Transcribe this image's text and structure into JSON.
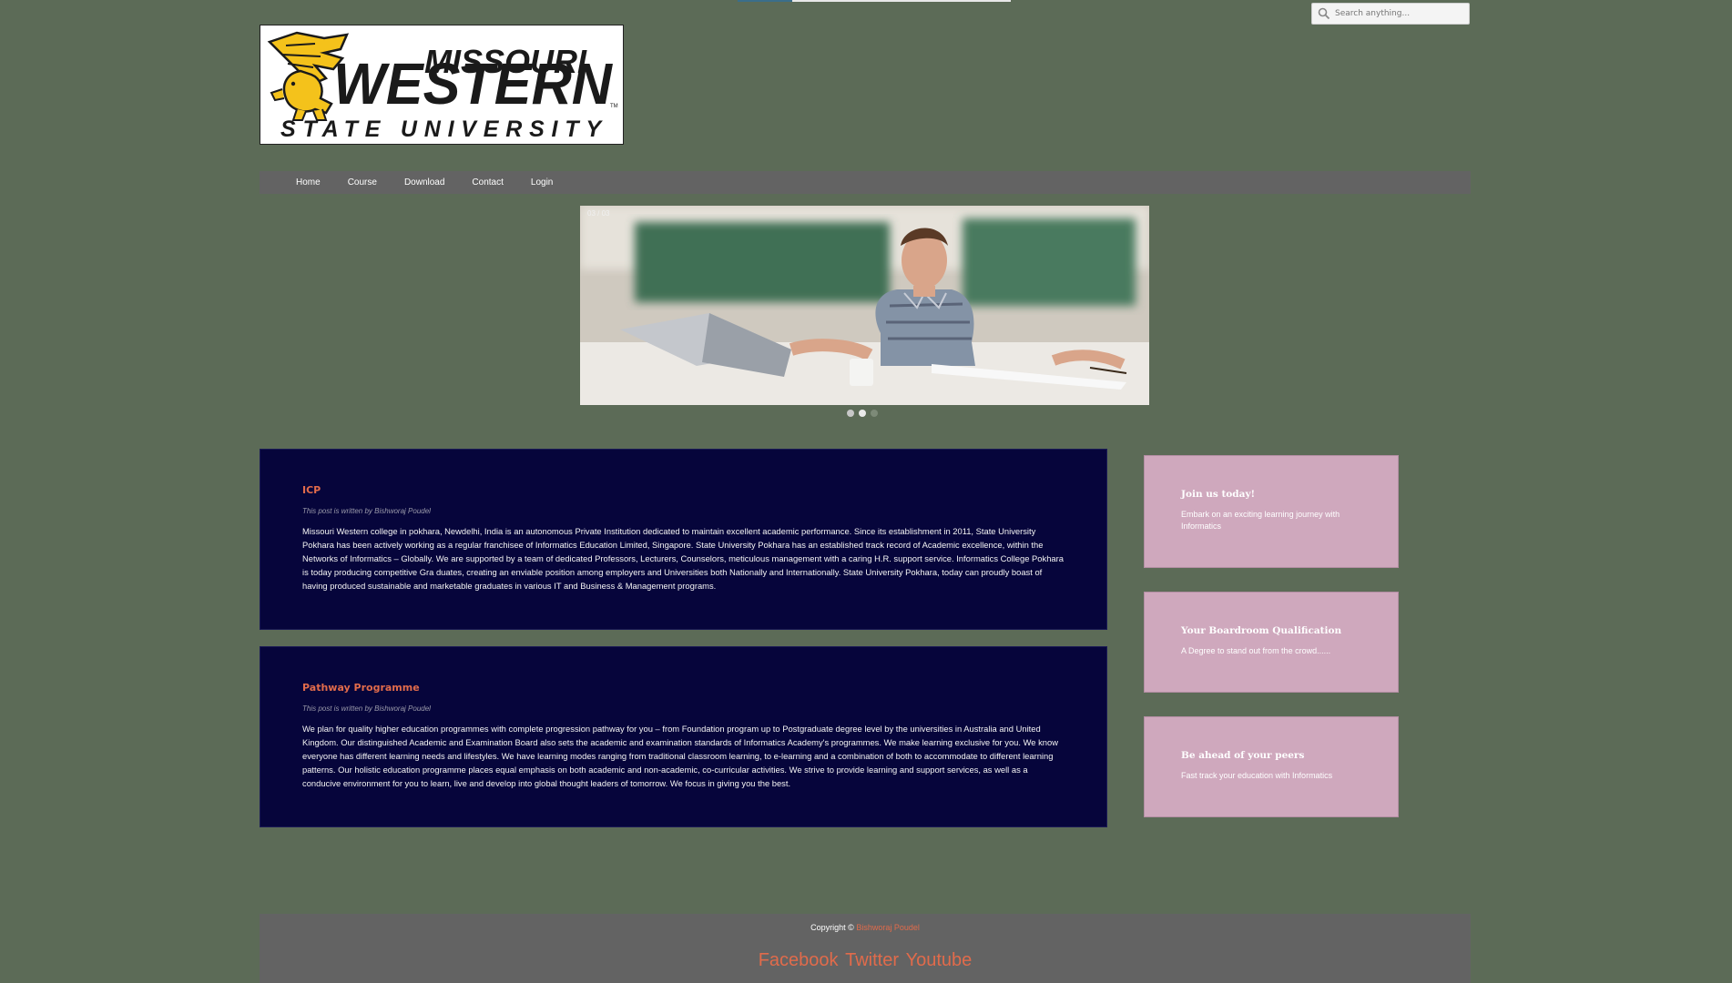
{
  "search": {
    "placeholder": "Search anything..."
  },
  "brand": {
    "logo_top": "MISSOURI",
    "logo_main": "WESTERN",
    "logo_bottom": "STATE UNIVERSITY",
    "logo_tm": "TM",
    "colors": {
      "gold": "#f4c21b",
      "black": "#1a1a1a"
    }
  },
  "nav": {
    "items": [
      "Home",
      "Course",
      "Download",
      "Contact",
      "Login"
    ]
  },
  "slider": {
    "counter": "03 / 03",
    "slide_count": 3,
    "active_index": 1
  },
  "posts": [
    {
      "title": "ICP",
      "byline": "This post is written by Bishworaj Poudel",
      "body": "Missouri Western college in pokhara, Newdelhi, India is an autonomous Private Institution dedicated to maintain excellent academic performance. Since its establishment in 2011, State University Pokhara has been actively working as a regular franchisee of Informatics Education Limited, Singapore. State University Pokhara has an established track record of Academic excellence, within the Networks of Informatics – Globally. We are supported by a team of dedicated Professors, Lecturers, Counselors, meticulous management with a caring H.R. support service. Informatics College Pokhara is today producing competitive Gra duates, creating an enviable position among employers and Universities both Nationally and Internationally. State University Pokhara, today can proudly boast of having produced sustainable and marketable graduates in various IT and Business & Management programs."
    },
    {
      "title": "Pathway Programme",
      "byline": "This post is written by Bishworaj Poudel",
      "body": "We plan for quality higher education programmes with complete progression pathway for you – from Foundation program up to Postgraduate degree level by the universities in Australia and United Kingdom. Our distinguished Academic and Examination Board also sets the academic and examination standards of Informatics Academy's programmes. We make learning exclusive for you. We know everyone has different learning needs and lifestyles. We have learning modes ranging from traditional classroom learning, to e-learning and a combination of both to accommodate to different learning patterns. Our holistic education programme places equal emphasis on both academic and non-academic, co-curricular activities. We strive to provide learning and support services, as well as a conducive environment for you to learn, live and develop into global thought leaders of tomorrow. We focus in giving you the best."
    }
  ],
  "promos": [
    {
      "title": "Join us today!",
      "text": "Embark on an exciting learning journey with Informatics"
    },
    {
      "title": "Your Boardroom Qualification",
      "text": "A Degree to stand out from the crowd......"
    },
    {
      "title": "Be ahead of your peers",
      "text": "Fast track your education with Informatics"
    }
  ],
  "footer": {
    "copyright_prefix": "Copyright ©",
    "author": "Bishworaj Poudel",
    "social": [
      "Facebook",
      "Twitter",
      "Youtube"
    ]
  },
  "colors": {
    "page_bg": "#5c6b57",
    "nav_bg": "#636363",
    "post_bg": "#06053b",
    "promo_bg": "#cfa8bd",
    "accent": "#e16b4b"
  }
}
